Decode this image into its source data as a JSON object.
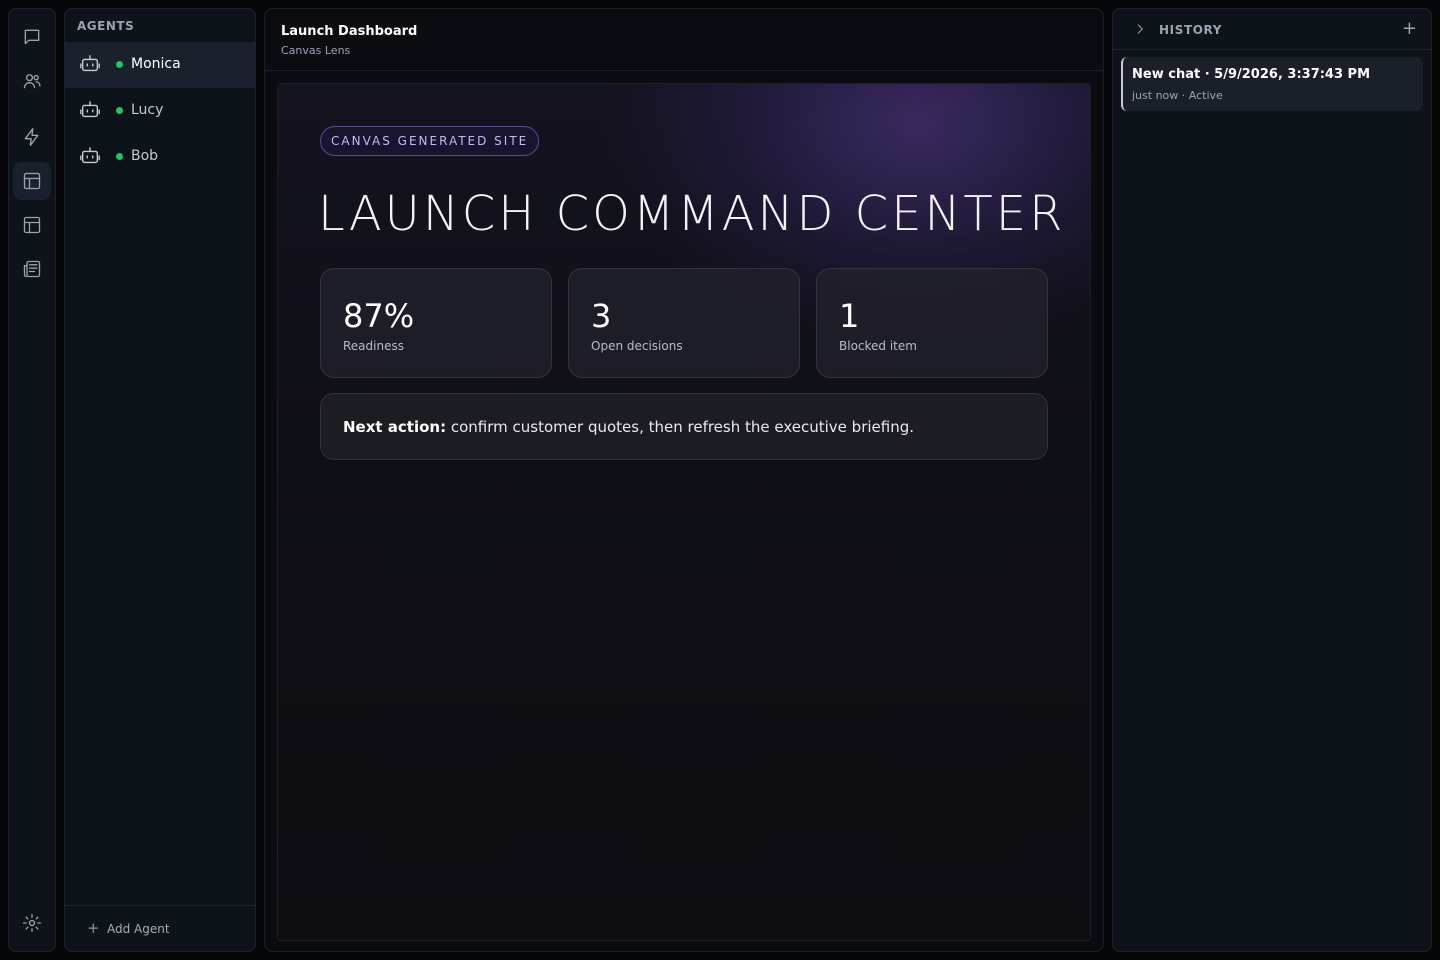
{
  "rail": {
    "icons": [
      "chat-icon",
      "users-icon",
      "lightning-icon",
      "layout-icon",
      "layout-alt-icon",
      "newspaper-icon",
      "gear-icon"
    ],
    "active_index": 3
  },
  "agents": {
    "title": "AGENTS",
    "items": [
      {
        "name": "Monica",
        "status_color": "#22c55e"
      },
      {
        "name": "Lucy",
        "status_color": "#22c55e"
      },
      {
        "name": "Bob",
        "status_color": "#22c55e"
      }
    ],
    "add_label": "Add Agent"
  },
  "main": {
    "title": "Launch Dashboard",
    "subtitle": "Canvas Lens",
    "canvas": {
      "badge": "CANVAS GENERATED SITE",
      "headline": "LAUNCH COMMAND CENTER",
      "stats": [
        {
          "value": "87%",
          "label": "Readiness"
        },
        {
          "value": "3",
          "label": "Open decisions"
        },
        {
          "value": "1",
          "label": "Blocked item"
        }
      ],
      "next_action": {
        "label": "Next action:",
        "text": " confirm customer quotes, then refresh the executive briefing."
      }
    }
  },
  "history": {
    "title": "HISTORY",
    "add_symbol": "+",
    "items": [
      {
        "title": "New chat · 5/9/2026, 3:37:43 PM",
        "meta": "just now · Active"
      }
    ]
  },
  "colors": {
    "accent": "#c6b8f4",
    "status_online": "#22c55e",
    "background": "#050608"
  }
}
